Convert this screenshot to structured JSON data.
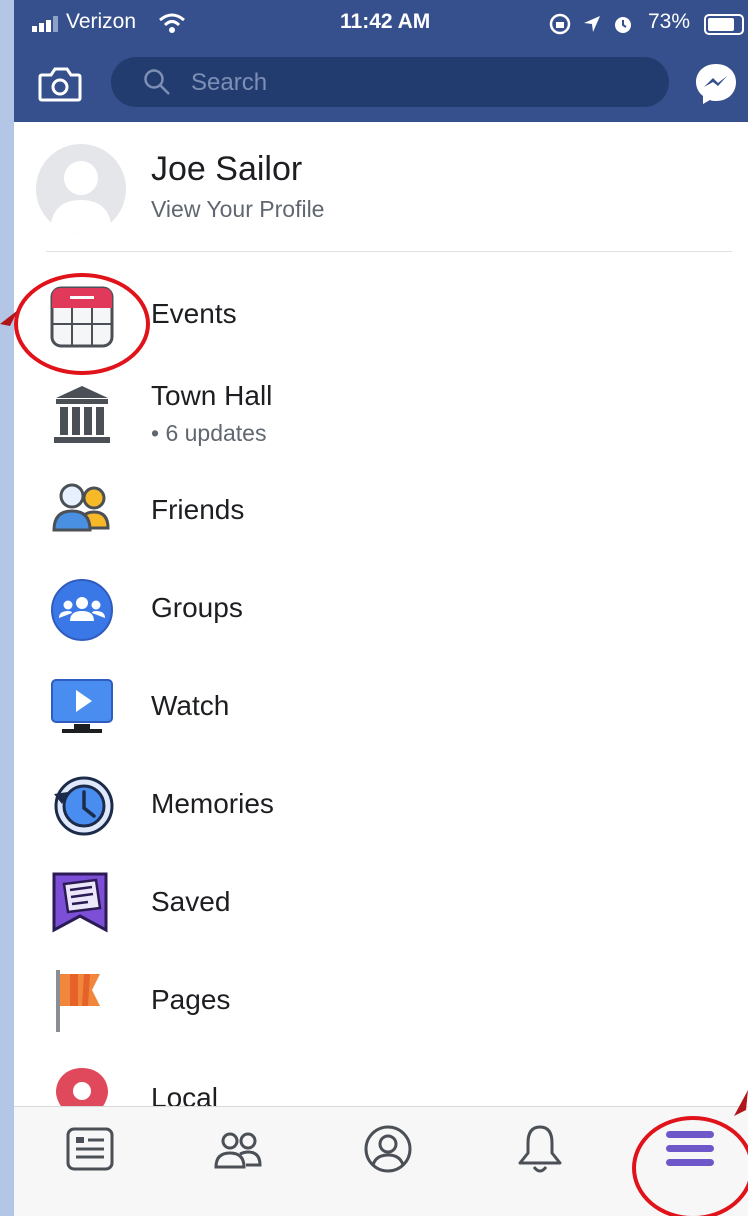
{
  "status_bar": {
    "carrier": "Verizon",
    "time": "11:42 AM",
    "battery": "73%"
  },
  "header": {
    "search_placeholder": "Search",
    "icons": [
      "camera-icon",
      "search-icon",
      "messenger-icon"
    ]
  },
  "profile": {
    "name": "Joe Sailor",
    "subtitle": "View Your Profile"
  },
  "menu": {
    "items": [
      {
        "label": "Events",
        "icon": "events-calendar-icon"
      },
      {
        "label": "Town Hall",
        "sub": "• 6 updates",
        "icon": "town-hall-icon"
      },
      {
        "label": "Friends",
        "icon": "friends-icon"
      },
      {
        "label": "Groups",
        "icon": "groups-icon"
      },
      {
        "label": "Watch",
        "icon": "watch-icon"
      },
      {
        "label": "Memories",
        "icon": "memories-icon"
      },
      {
        "label": "Saved",
        "icon": "saved-icon"
      },
      {
        "label": "Pages",
        "icon": "pages-flag-icon"
      },
      {
        "label": "Local",
        "icon": "local-pin-icon"
      }
    ]
  },
  "tab_bar": {
    "tabs": [
      "news-feed-icon",
      "friends-requests-icon",
      "profile-icon",
      "notifications-icon",
      "menu-icon"
    ],
    "active": "menu-icon"
  },
  "colors": {
    "header_bg": "#35508c",
    "annotation": "#e0131b",
    "accent": "#4267b2"
  }
}
